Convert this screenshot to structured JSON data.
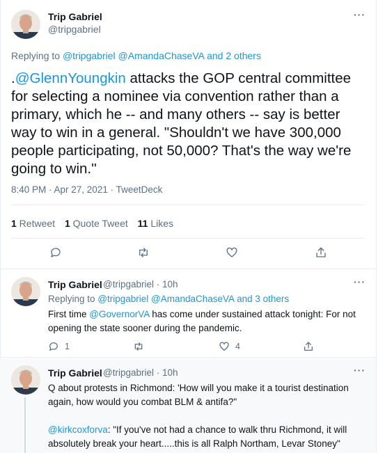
{
  "main_tweet": {
    "author_name": "Trip Gabriel",
    "author_handle": "@tripgabriel",
    "replying_prefix": "Replying to ",
    "replying_users": "@tripgabriel @AmandaChaseVA",
    "replying_suffix": " and 2 others",
    "text_prefix": ".",
    "text_mention": "@GlennYoungkin",
    "text_body": " attacks the GOP central committee for selecting a nominee via convention rather than a primary, which he -- and many others -- say is better way to win in a general. \"Shouldn't we have 300,000 people participating, not 50,000? That's the way we're going to win.''",
    "timestamp": "8:40 PM · Apr 27, 2021 · TweetDeck",
    "retweets_count": "1",
    "retweets_label": " Retweet",
    "quotes_count": "1",
    "quotes_label": " Quote Tweet",
    "likes_count": "11",
    "likes_label": " Likes",
    "more_label": "···"
  },
  "replies": [
    {
      "author_name": "Trip Gabriel",
      "handle_time": "@tripgabriel · 10h",
      "replying_prefix": "Replying to ",
      "replying_users": "@tripgabriel @AmandaChaseVA",
      "replying_suffix": " and 3 others",
      "text_prefix": "First time ",
      "text_mention": "@GovernorVA",
      "text_body": " has come under sustained attack tonight: For not opening the state sooner during the pandemic.",
      "reply_count": "1",
      "like_count": "4",
      "more_label": "···"
    },
    {
      "author_name": "Trip Gabriel",
      "handle_time": "@tripgabriel · 10h",
      "text_line1": "Q about protests in Richmond: 'How will you make it a tourist destination again, how would you combat BLM & antifa?\"",
      "text_mention": "@kirkcoxforva",
      "text_line2": ": \"If you've not had a chance to walk thru Richmond, it will absolutely break your heart.....this is all Ralph Northam, Levar Stoney\"",
      "more_label": "···"
    }
  ],
  "icons": {
    "reply": "reply-icon",
    "retweet": "retweet-icon",
    "like": "like-icon",
    "share": "share-icon"
  },
  "colors": {
    "link": "#1b95e0",
    "secondary": "#5b7083",
    "border": "#e6ecf0"
  }
}
